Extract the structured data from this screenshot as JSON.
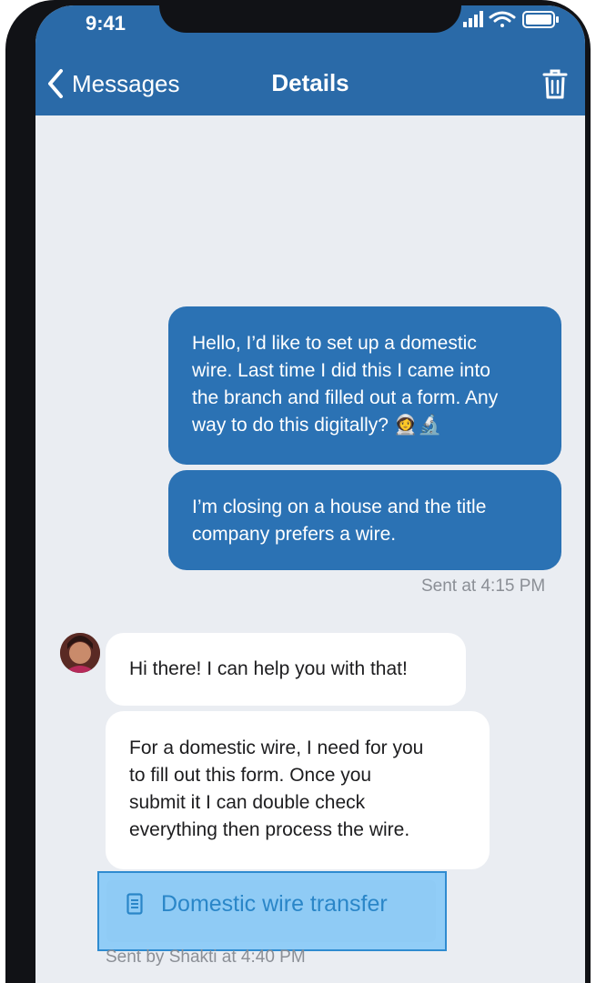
{
  "status_bar": {
    "time": "9:41"
  },
  "nav": {
    "back_label": "Messages",
    "title": "Details"
  },
  "messages": {
    "outgoing_1": [
      "Hello, I’d like to set up a  domestic",
      "wire. Last time I did this I came into",
      "the branch and filled out a form. Any",
      "way to do this digitally?"
    ],
    "outgoing_1_emoji": "👩‍🚀🔬",
    "outgoing_2": [
      "I’m closing on a house and the title",
      "company prefers a wire."
    ],
    "outgoing_meta": "Sent at 4:15 PM",
    "incoming_1": "Hi there! I can help you with that!",
    "incoming_2": [
      "For a domestic wire, I need for you",
      "to fill out this form. Once you",
      "submit it I can double check",
      "everything then process the wire."
    ],
    "attachment_label": "Domestic wire transfer",
    "incoming_meta": "Sent by Shakti at 4:40 PM"
  },
  "colors": {
    "header": "#2a6aa8",
    "outgoing_bubble": "#2b72b4",
    "incoming_bubble": "#ffffff",
    "background": "#eaedf2",
    "attachment_highlight": "#91cdf7",
    "attachment_text": "#2a86c8"
  },
  "icons": {
    "back": "chevron-left-icon",
    "delete": "trash-icon",
    "attachment": "document-icon",
    "signal": "signal-icon",
    "wifi": "wifi-icon",
    "battery": "battery-icon"
  }
}
